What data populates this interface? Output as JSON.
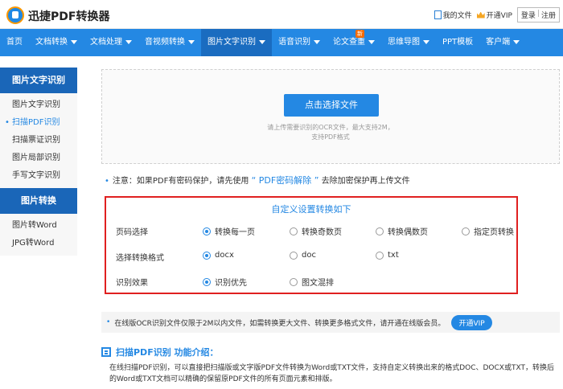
{
  "header": {
    "app_title": "迅捷PDF转换器",
    "my_files": "我的文件",
    "open_vip": "开通VIP",
    "login": "登录",
    "separator": "|",
    "register": "注册"
  },
  "nav": {
    "items": [
      {
        "label": "首页",
        "dropdown": false
      },
      {
        "label": "文档转换",
        "dropdown": true
      },
      {
        "label": "文档处理",
        "dropdown": true
      },
      {
        "label": "音视频转换",
        "dropdown": true
      },
      {
        "label": "图片文字识别",
        "dropdown": true,
        "active": true
      },
      {
        "label": "语音识别",
        "dropdown": true
      },
      {
        "label": "论文查重",
        "dropdown": true,
        "badge": "新"
      },
      {
        "label": "思维导图",
        "dropdown": true
      },
      {
        "label": "PPT模板",
        "dropdown": false
      },
      {
        "label": "客户端",
        "dropdown": true
      }
    ]
  },
  "sidebar": {
    "section1_title": "图片文字识别",
    "section1_items": [
      "图片文字识别",
      "扫描PDF识别",
      "扫描票证识别",
      "图片局部识别",
      "手写文字识别"
    ],
    "section1_active": 1,
    "section2_title": "图片转换",
    "section2_items": [
      "图片转Word",
      "JPG转Word"
    ]
  },
  "upload": {
    "button_label": "点击选择文件",
    "hint_line1": "请上传需要识别的OCR文件，最大支持2M，",
    "hint_line2": "支持PDF格式"
  },
  "note": {
    "prefix": "注意：如果PDF有密码保护，请先使用",
    "link": "“ PDF密码解除 ”",
    "suffix": "去除加密保护再上传文件"
  },
  "settings": {
    "title": "自定义设置转换如下",
    "page_label": "页码选择",
    "page_options": [
      "转换每一页",
      "转换奇数页",
      "转换偶数页",
      "指定页转换"
    ],
    "page_selected": 0,
    "format_label": "选择转换格式",
    "format_options": [
      "docx",
      "doc",
      "txt"
    ],
    "format_selected": 0,
    "effect_label": "识别效果",
    "effect_options": [
      "识别优先",
      "图文混排"
    ],
    "effect_selected": 0
  },
  "info": {
    "text": "在线版OCR识别文件仅限于2M以内文件，如需转换更大文件、转换更多格式文件，请开通在线版会员。",
    "vip_button": "开通VIP"
  },
  "intro": {
    "title": "扫描PDF识别 功能介绍：",
    "text": "在线扫描PDF识别，可以直接把扫描版或文字版PDF文件转换为Word或TXT文件，支持自定义转换出来的格式DOC、DOCX或TXT，转换后的Word或TXT文档可以精确的保留原PDF文件的所有页面元素和排版。"
  },
  "colors": {
    "accent": "#2488e3",
    "nav_active": "#1a6cc0",
    "sidebar_header": "#1a66b8",
    "highlight_border": "#e02020"
  }
}
